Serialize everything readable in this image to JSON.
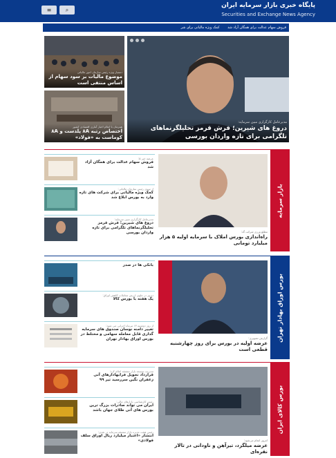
{
  "header": {
    "title": "پایگاه خبری بازار سرمایه ایران",
    "subtitle": "Securities and Exchange News Agency",
    "menu_icon": "≡",
    "search_icon": "⌕"
  },
  "ticker": [
    "فروش سهام عدالت برای همگان آزاد شد",
    "کمک ویژه مالیاتی برای شر"
  ],
  "top": {
    "lead": [
      {
        "kicker": "دستیار ویژه رئیس سازمان امور مالیاتی",
        "title": "موضوع مالیات بر سود سهام از اساس منتفی است"
      },
      {
        "kicker": "همزمان با اعلام اخبار آماری اقتصادی کشور",
        "title": "اختصاص رتبه ۸A پلدست و ۸A کوماست به «فولاد»"
      }
    ],
    "hero": {
      "kicker": "مدیرعامل کارگزاری مبین سرمایه:",
      "title": "دروغ های شیرین؛ فرش قرمز تحلیلگرنماهای تلگرامی برای تازه واردان بورسی"
    }
  },
  "sections": [
    {
      "label": "بازار سرمایه",
      "big": {
        "kicker": "مطلع ورزی شرکت گذ:",
        "title": "راه‌اندازی بورس املاک با سرمایه اولیه ۵ هزار میلیارد تومانی"
      },
      "items": [
        {
          "kicker": "عرضه خبر ۵:",
          "title": "فروش سهام عدالت برای همگان آزاد شد"
        },
        {
          "kicker": "از سوی رئیس سازمان مالیاتی:",
          "title": "کمک ویژه مالیاتی برای شرکت های تازه وارد به بورس ابلاغ شد"
        },
        {
          "kicker": "مدیرعامل کارگزاری مبین سرمایه:",
          "title": "دروغ های شیرین؛ فرش قرمز تحلیلگرنماهای تلگرامی برای تازه واردان بورسی"
        }
      ]
    },
    {
      "label": "بورس اوراق بهادار تهران",
      "big": {
        "kicker": "گزارش تصویری:",
        "title": "عرضه اولیه در بورس برای روز چهارشنبه قطعی است"
      },
      "items": [
        {
          "kicker": "",
          "title": "بانکی ها در صدر"
        },
        {
          "kicker": "دیروز در جلوی ارزش معاملات کاهش اوراق:",
          "title": "یک هفته با بورس کالا"
        },
        {
          "kicker": "از روز دوشنبه ۱۳ تیرماه اجرایی می شود:",
          "title": "تغییر دامنه نوسان صندوق های سرمایه گذاری قابل معامله سهامی و مختلط در بورس اوراق بهادار تهران"
        }
      ]
    },
    {
      "label": "بورس کالای ایران",
      "big": {
        "kicker": "امروز انجام می‌شود:",
        "title": "عرضه میلگرد، تیرآهن و ناودانی در تالار نقره‌ای"
      },
      "items": [
        {
          "kicker": "مدیریت توسعه بازار مشتقه اعلام کرد:",
          "title": "قرارداد تحویل فرابهادارهای آتی زعفران نگین سررسید تیر ۹۹"
        },
        {
          "kicker": "رئیس کارشناسی بازارهای مالی:",
          "title": "ایران می تواند صادرات بزرگ ترین بورس های آتی طلای جهان باشد"
        },
        {
          "kicker": "رئیس هیئت مدیره بازار مشتقه سرمایه در نقدی:",
          "title": "انتشار «اعتبار میلیارد ریال اوراق سلف فولادی»"
        }
      ]
    }
  ]
}
